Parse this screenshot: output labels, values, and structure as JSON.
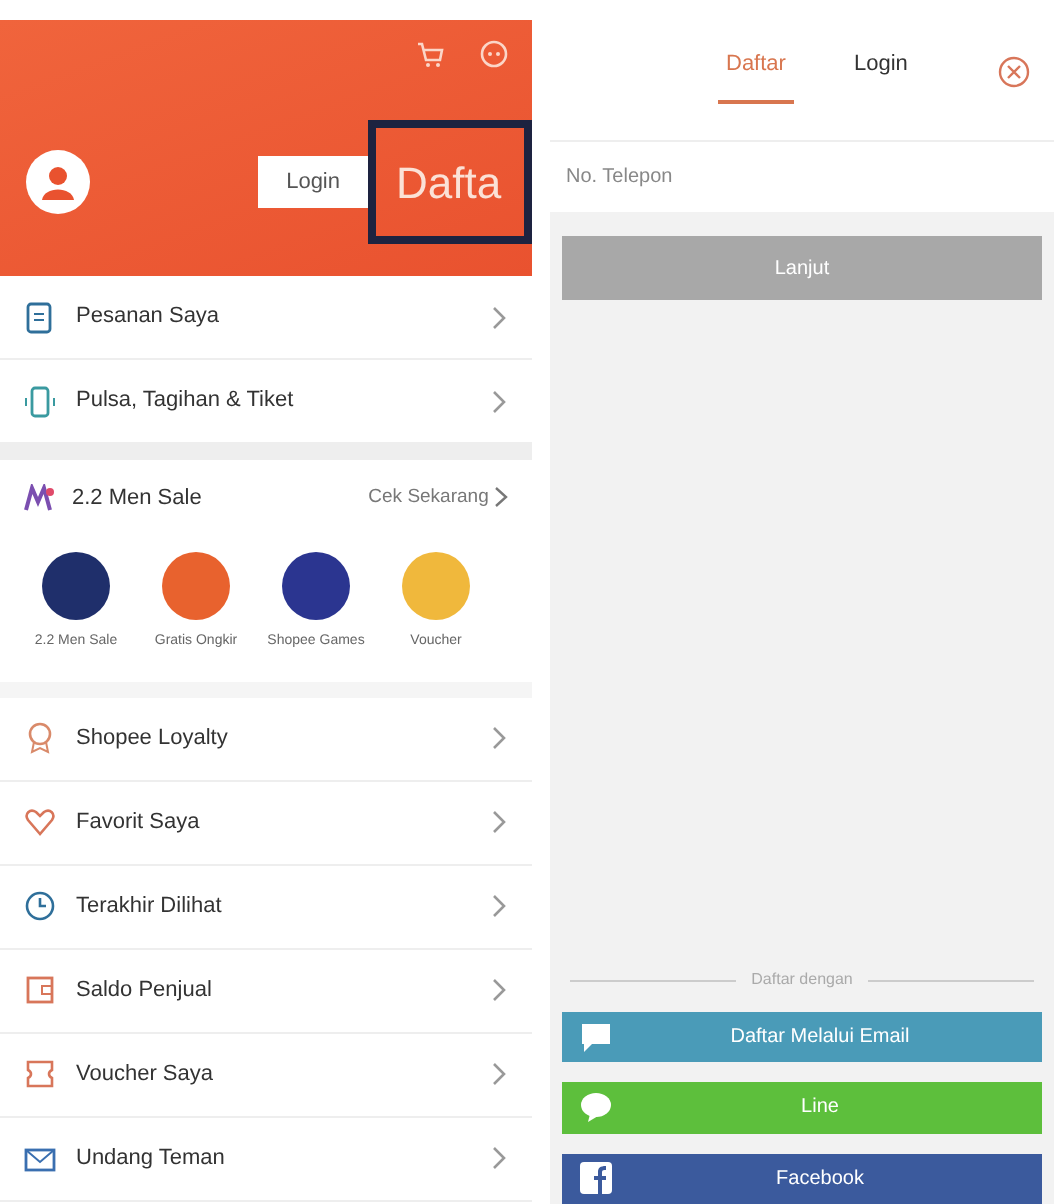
{
  "profile": {
    "login_button": "Login",
    "register_button": "Dafta"
  },
  "menu_top": [
    {
      "label": "Pesanan Saya",
      "kind": "orders"
    },
    {
      "label": "Pulsa, Tagihan & Tiket",
      "kind": "phone"
    }
  ],
  "promo": {
    "title": "2.2 Men Sale",
    "link": "Cek Sekarang",
    "shortcuts": [
      {
        "label": "2.2 Men Sale",
        "color": "#1f2f6b"
      },
      {
        "label": "Gratis Ongkir",
        "color": "#e8622e"
      },
      {
        "label": "Shopee Games",
        "color": "#2b3590"
      },
      {
        "label": "Voucher",
        "color": "#f0b83c"
      }
    ]
  },
  "menu_bottom": [
    {
      "label": "Shopee Loyalty",
      "kind": "medal"
    },
    {
      "label": "Favorit Saya",
      "kind": "heart"
    },
    {
      "label": "Terakhir Dilihat",
      "kind": "clock"
    },
    {
      "label": "Saldo Penjual",
      "kind": "wallet"
    },
    {
      "label": "Voucher Saya",
      "kind": "voucher"
    },
    {
      "label": "Undang Teman",
      "kind": "mail"
    }
  ],
  "auth": {
    "tabs": [
      {
        "label": "Daftar",
        "selected": true
      },
      {
        "label": "Login",
        "selected": false
      }
    ],
    "phone_field": {
      "placeholder": "No. Telepon"
    },
    "continue_button": "Lanjut",
    "divider_text": "Daftar dengan",
    "social_buttons": [
      {
        "label": "Daftar Melalui Email",
        "kind": "email",
        "color": "#4a9bb8"
      },
      {
        "label": "Line",
        "kind": "line",
        "color": "#5dbf3c"
      },
      {
        "label": "Facebook",
        "kind": "facebook",
        "color": "#3b5a9d"
      }
    ]
  }
}
